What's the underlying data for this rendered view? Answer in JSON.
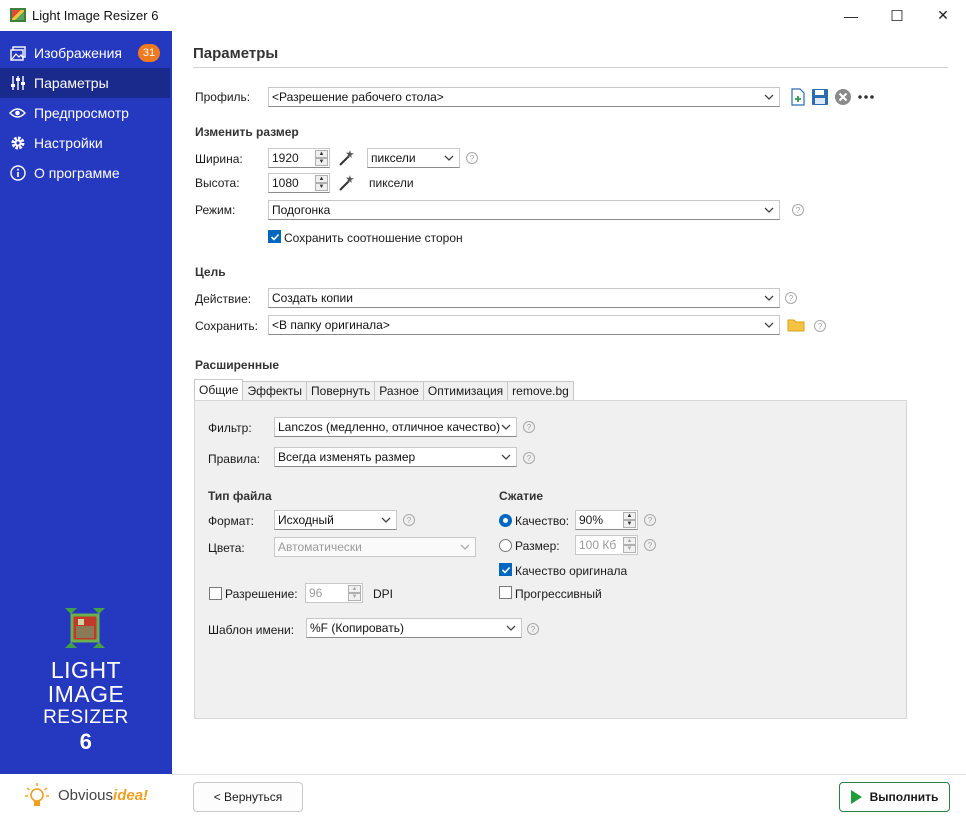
{
  "window": {
    "title": "Light Image Resizer 6",
    "minimize": "—",
    "maximize": "☐",
    "close": "✕"
  },
  "sidebar": {
    "items": [
      {
        "label": "Изображения",
        "icon": "images-icon",
        "badge": "31"
      },
      {
        "label": "Параметры",
        "icon": "sliders-icon",
        "active": true
      },
      {
        "label": "Предпросмотр",
        "icon": "eye-icon"
      },
      {
        "label": "Настройки",
        "icon": "gear-icon"
      },
      {
        "label": "О программе",
        "icon": "info-icon"
      }
    ],
    "logo": {
      "line1": "LIGHT",
      "line2": "IMAGE",
      "line3": "RESIZER",
      "line4": "6"
    },
    "vendor": {
      "name_main": "Obvious",
      "name_accent": "idea!"
    }
  },
  "page": {
    "title": "Параметры"
  },
  "profile": {
    "label": "Профиль:",
    "value": "<Разрешение рабочего стола>"
  },
  "resize": {
    "section": "Изменить размер",
    "width_label": "Ширина:",
    "width_value": "1920",
    "height_label": "Высота:",
    "height_value": "1080",
    "unit_select": "пиксели",
    "unit_text": "пиксели",
    "mode_label": "Режим:",
    "mode_value": "Подогонка",
    "keep_ratio_label": "Сохранить соотношение сторон",
    "keep_ratio_checked": true
  },
  "target": {
    "section": "Цель",
    "action_label": "Действие:",
    "action_value": "Создать копии",
    "save_label": "Сохранить:",
    "save_value": "<В папку оригинала>"
  },
  "advanced": {
    "section": "Расширенные",
    "tabs": [
      "Общие",
      "Эффекты",
      "Повернуть",
      "Разное",
      "Оптимизация",
      "remove.bg"
    ],
    "active_tab": "Общие",
    "filter_label": "Фильтр:",
    "filter_value": "Lanczos  (медленно, отличное качество)",
    "rules_label": "Правила:",
    "rules_value": "Всегда изменять размер",
    "filetype_section": "Тип файла",
    "format_label": "Формат:",
    "format_value": "Исходный",
    "colors_label": "Цвета:",
    "colors_value": "Автоматически",
    "resolution_label": "Разрешение:",
    "resolution_value": "96",
    "resolution_unit": "DPI",
    "naming_label": "Шаблон имени:",
    "naming_value": "%F (Копировать)",
    "compression_section": "Сжатие",
    "quality_label": "Качество:",
    "quality_value": "90%",
    "size_label": "Размер:",
    "size_value": "100 Кб",
    "original_quality_label": "Качество оригинала",
    "progressive_label": "Прогрессивный"
  },
  "footer": {
    "back_label": "< Вернуться",
    "run_label": "Выполнить"
  },
  "colors": {
    "sidebar": "#2538c0",
    "sidebar_active": "#1a2a8c",
    "badge": "#f07a1e",
    "accent": "#0067c0",
    "run_icon": "#1e9e3a"
  }
}
